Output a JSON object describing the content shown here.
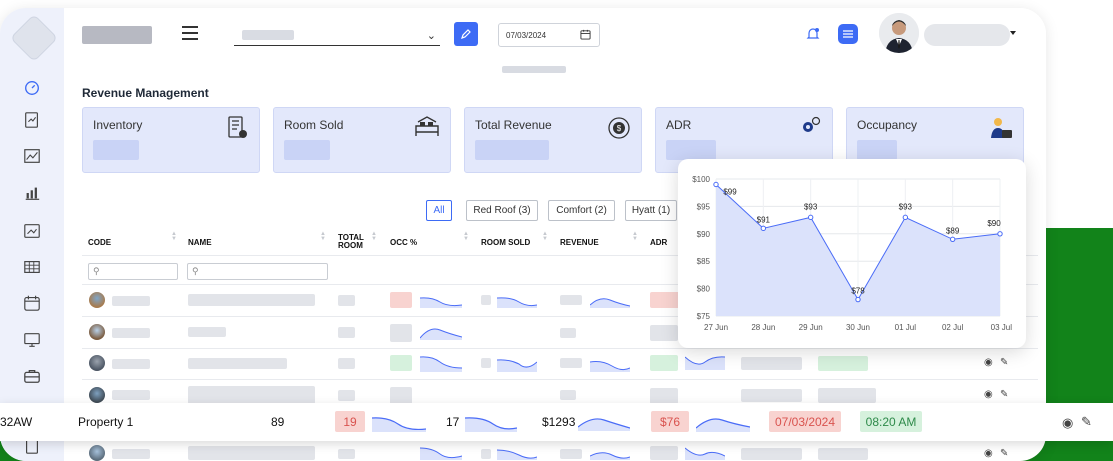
{
  "header": {
    "date_value": "07/03/2024",
    "icons": [
      "menu-icon",
      "edit-icon",
      "calendar-icon",
      "bell-icon",
      "list-icon",
      "user-avatar"
    ]
  },
  "page": {
    "title": "Revenue Management"
  },
  "cards": [
    {
      "label": "Inventory",
      "icon": "inventory-icon"
    },
    {
      "label": "Room Sold",
      "icon": "room-sold-icon"
    },
    {
      "label": "Total Revenue",
      "icon": "revenue-icon"
    },
    {
      "label": "ADR",
      "icon": "gears-icon"
    },
    {
      "label": "Occupancy",
      "icon": "occupancy-icon"
    }
  ],
  "filters": [
    {
      "label": "All",
      "active": true
    },
    {
      "label": "Red Roof (3)",
      "active": false
    },
    {
      "label": "Comfort (2)",
      "active": false
    },
    {
      "label": "Hyatt (1)",
      "active": false
    }
  ],
  "table": {
    "columns": {
      "code": "CODE",
      "name": "NAME",
      "total_room_1": "TOTAL",
      "total_room_2": "ROOM",
      "occ": "OCC %",
      "room_sold": "ROOM SOLD",
      "revenue": "REVENUE",
      "adr": "ADR"
    }
  },
  "highlight_row": {
    "code": "32AW",
    "name": "Property 1",
    "total_room": "89",
    "occ": "19",
    "room_sold": "17",
    "revenue": "$1293",
    "adr": "$76",
    "date": "07/03/2024",
    "time": "08:20 AM"
  },
  "chart_data": {
    "type": "area",
    "x": [
      "27 Jun",
      "28 Jun",
      "29 Jun",
      "30 Jun",
      "01 Jul",
      "02 Jul",
      "03 Jul"
    ],
    "values": [
      99,
      91,
      93,
      78,
      93,
      89,
      90
    ],
    "data_labels": [
      "$99",
      "$91",
      "$93",
      "$78",
      "$93",
      "$89",
      "$90"
    ],
    "y_ticks": [
      "$100",
      "$95",
      "$90",
      "$85",
      "$80",
      "$75"
    ],
    "ylim": [
      75,
      100
    ],
    "grid": true,
    "color": "#4a6cf7",
    "fill": "#dbe2fb"
  },
  "colors": {
    "accent": "#3d6bf5",
    "card_bg": "#e3e8fb",
    "badge_red": "#f8d3d0",
    "badge_green": "#d6f1dd",
    "backdrop_green": "#12831a"
  }
}
